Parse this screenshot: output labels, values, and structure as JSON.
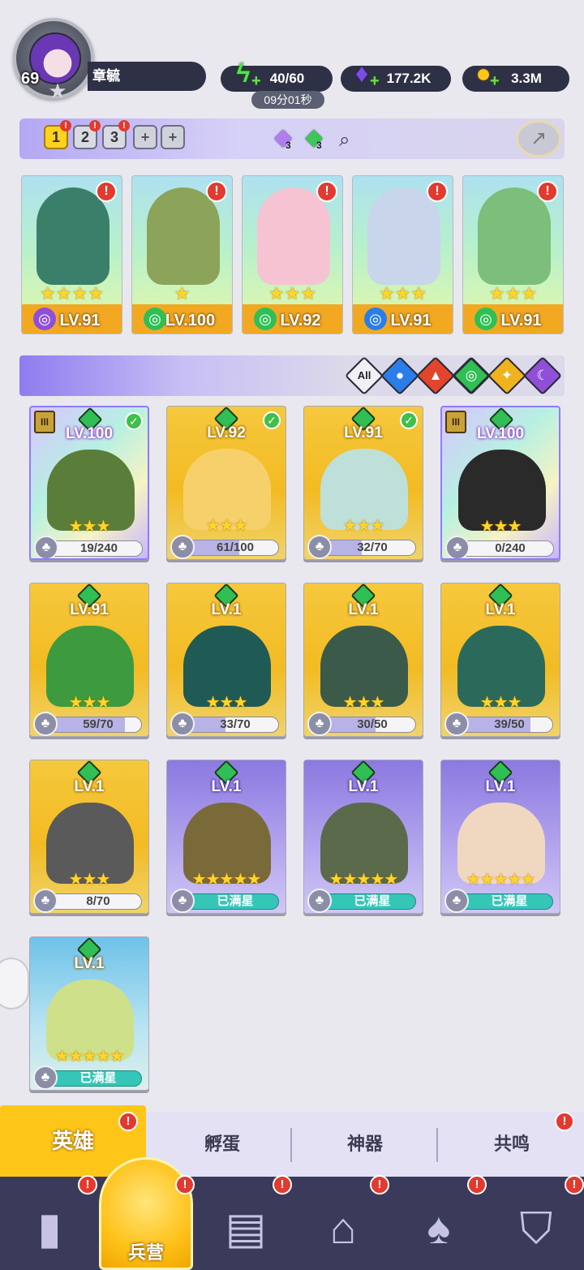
{
  "player": {
    "level": "69",
    "name": "章毓"
  },
  "resources": {
    "energy": "40/60",
    "energy_timer": "09分01秒",
    "gems": "177.2K",
    "gold": "3.3M"
  },
  "team_tabs": [
    "1",
    "2",
    "3",
    "+",
    "+"
  ],
  "crystals": [
    {
      "count": "3",
      "color": "#b27cf0"
    },
    {
      "count": "3",
      "color": "#3dc65a"
    }
  ],
  "team": [
    {
      "lv": "LV.91",
      "stars": "★★★★",
      "element_color": "#8f4fd8"
    },
    {
      "lv": "LV.100",
      "stars": "★",
      "element_color": "#2fbf55"
    },
    {
      "lv": "LV.92",
      "stars": "★★★",
      "element_color": "#2fbf55"
    },
    {
      "lv": "LV.91",
      "stars": "★★★",
      "element_color": "#2b7de9"
    },
    {
      "lv": "LV.91",
      "stars": "★★★",
      "element_color": "#2fbf55"
    }
  ],
  "filters": {
    "all_label": "All"
  },
  "heroes": [
    {
      "lv": "LV.100",
      "progress": "19/240",
      "fill": 0.08,
      "style": "holo",
      "check": true,
      "rank": "III"
    },
    {
      "lv": "LV.92",
      "progress": "61/100",
      "fill": 0.61,
      "style": "gold",
      "check": true,
      "rank": ""
    },
    {
      "lv": "LV.91",
      "progress": "32/70",
      "fill": 0.46,
      "style": "gold",
      "check": true,
      "rank": ""
    },
    {
      "lv": "LV.100",
      "progress": "0/240",
      "fill": 0.0,
      "style": "holo",
      "check": false,
      "rank": "III"
    },
    {
      "lv": "LV.91",
      "progress": "59/70",
      "fill": 0.84,
      "style": "gold",
      "check": false,
      "rank": ""
    },
    {
      "lv": "LV.1",
      "progress": "33/70",
      "fill": 0.47,
      "style": "gold",
      "check": false,
      "rank": ""
    },
    {
      "lv": "LV.1",
      "progress": "30/50",
      "fill": 0.6,
      "style": "gold",
      "check": false,
      "rank": ""
    },
    {
      "lv": "LV.1",
      "progress": "39/50",
      "fill": 0.78,
      "style": "gold",
      "check": false,
      "rank": ""
    },
    {
      "lv": "LV.1",
      "progress": "8/70",
      "fill": 0.11,
      "style": "gold",
      "check": false,
      "rank": ""
    },
    {
      "lv": "LV.1",
      "progress": "已满星",
      "fill": 1.0,
      "style": "purple",
      "check": false,
      "rank": ""
    },
    {
      "lv": "LV.1",
      "progress": "已满星",
      "fill": 1.0,
      "style": "purple",
      "check": false,
      "rank": ""
    },
    {
      "lv": "LV.1",
      "progress": "已满星",
      "fill": 1.0,
      "style": "purple",
      "check": false,
      "rank": ""
    },
    {
      "lv": "LV.1",
      "progress": "已满星",
      "fill": 1.0,
      "style": "blue",
      "check": false,
      "rank": ""
    }
  ],
  "subtabs": [
    "英雄",
    "孵蛋",
    "神器",
    "共鸣"
  ],
  "nav": {
    "active_label": "兵营"
  },
  "alert_mark": "!"
}
